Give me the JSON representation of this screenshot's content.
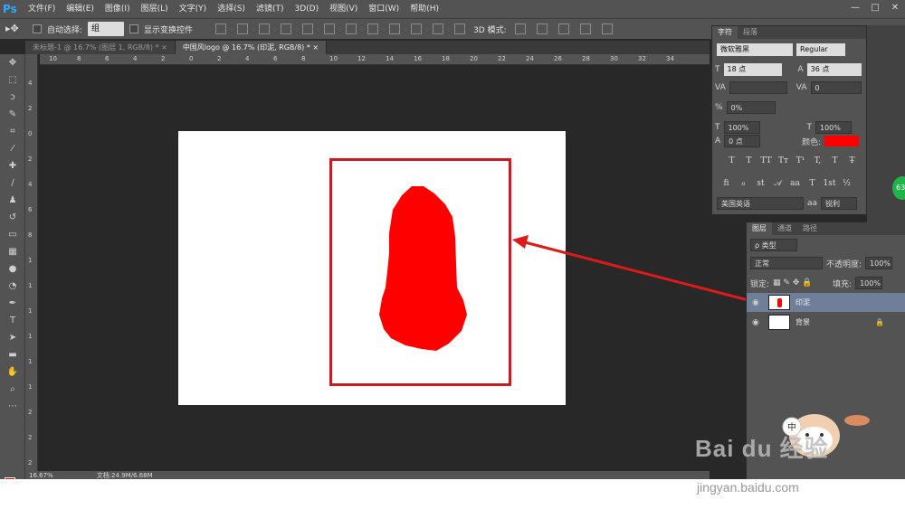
{
  "app": {
    "logo": "Ps"
  },
  "menu": [
    "文件(F)",
    "编辑(E)",
    "图像(I)",
    "图层(L)",
    "文字(Y)",
    "选择(S)",
    "滤镜(T)",
    "3D(D)",
    "视图(V)",
    "窗口(W)",
    "帮助(H)"
  ],
  "window_controls": [
    "—",
    "□",
    "✕"
  ],
  "options": {
    "auto_select_label": "自动选择:",
    "auto_select_value": "组",
    "show_transform_label": "显示变换控件",
    "mode3d_label": "3D 模式:"
  },
  "tabs": [
    {
      "label": "未标题-1 @ 16.7% (图层 1, RGB/8) *",
      "close": "×"
    },
    {
      "label": "中国风logo @ 16.7% (印泥, RGB/8) *",
      "close": "×"
    }
  ],
  "ruler_h": [
    "10",
    "8",
    "6",
    "4",
    "2",
    "0",
    "2",
    "4",
    "6",
    "8",
    "10",
    "12",
    "14",
    "16",
    "18",
    "20",
    "22",
    "24",
    "26",
    "28",
    "30",
    "32",
    "34"
  ],
  "ruler_v": [
    "4",
    "2",
    "0",
    "2",
    "4",
    "6",
    "8",
    "1",
    "1",
    "1",
    "1",
    "1",
    "1",
    "2",
    "2",
    "2"
  ],
  "statusbar": {
    "zoom": "16.67%",
    "doc": "文档:24.9M/6.68M"
  },
  "character_panel": {
    "tabs": [
      "字符",
      "段落"
    ],
    "font_family": "微软雅黑",
    "font_style": "Regular",
    "size": "18 点",
    "leading": "36 点",
    "tracking": "0",
    "kerning_label": "VA",
    "baseline_shift_pct": "0%",
    "vscale": "100%",
    "hscale": "100%",
    "baseline": "0 点",
    "color_label": "颜色:",
    "type_buttons": [
      "T",
      "T",
      "TT",
      "Tт",
      "T¹",
      "T,",
      "T",
      "T̶"
    ],
    "language": "美国英语",
    "aa_label": "aa",
    "antialias": "锐利",
    "color": "#ff0000"
  },
  "layers_panel": {
    "tabs": [
      "图层",
      "通道",
      "路径"
    ],
    "filter": "ρ 类型",
    "blend": "正常",
    "opacity_label": "不透明度:",
    "opacity": "100%",
    "lock_label": "锁定:",
    "fill_label": "填充:",
    "fill": "100%",
    "layers": [
      {
        "name": "印泥",
        "selected": true
      },
      {
        "name": "背景",
        "selected": false
      }
    ]
  },
  "green_badge": "63",
  "watermark": {
    "brand": "Bai du 经验",
    "url": "jingyan.baidu.com"
  }
}
